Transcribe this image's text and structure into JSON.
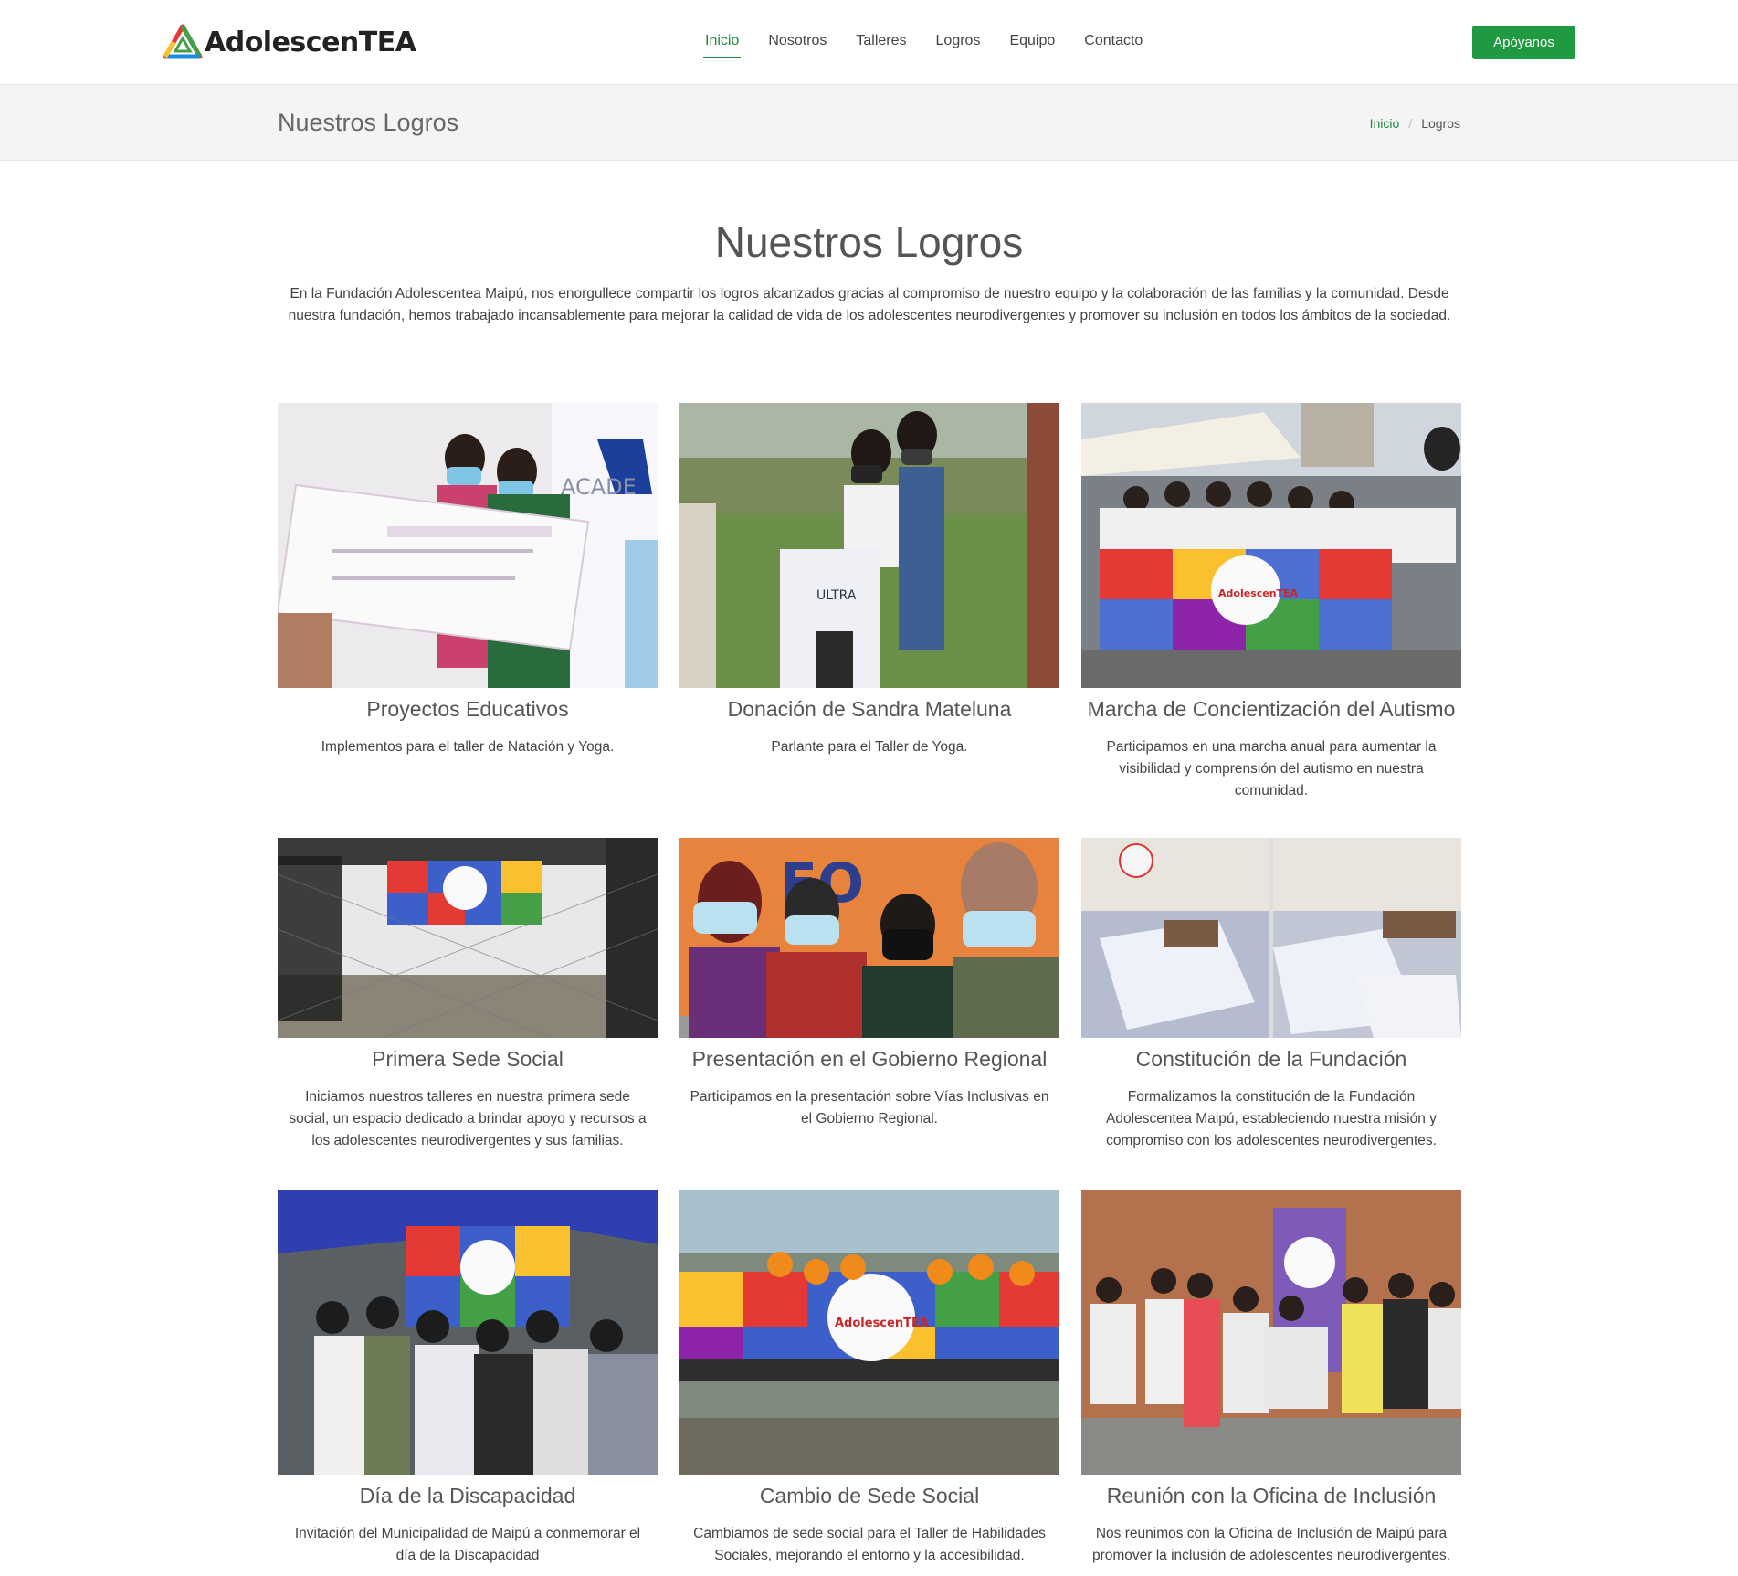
{
  "brand": {
    "name": "AdolescenTEA"
  },
  "nav": {
    "items": [
      "Inicio",
      "Nosotros",
      "Talleres",
      "Logros",
      "Equipo",
      "Contacto"
    ],
    "active": "Inicio",
    "cta": "Apóyanos"
  },
  "page_header": {
    "title": "Nuestros Logros",
    "breadcrumb": {
      "home": "Inicio",
      "separator": "/",
      "current": "Logros"
    }
  },
  "main": {
    "title": "Nuestros Logros",
    "intro": "En la Fundación Adolescentea Maipú, nos enorgullece compartir los logros alcanzados gracias al compromiso de nuestro equipo y la colaboración de las familias y la comunidad. Desde nuestra fundación, hemos trabajado incansablemente para mejorar la calidad de vida de los adolescentes neurodivergentes y promover su inclusión en todos los ámbitos de la sociedad.",
    "cards": [
      {
        "title": "Proyectos Educativos",
        "text": "Implementos para el taller de Natación y Yoga.",
        "photo": "check-ceremony-photo"
      },
      {
        "title": "Donación de Sandra Mateluna",
        "text": "Parlante para el Taller de Yoga.",
        "photo": "speaker-donation-photo"
      },
      {
        "title": "Marcha de Concientización del Autismo",
        "text": "Participamos en una marcha anual para aumentar la visibilidad y comprensión del autismo en nuestra comunidad.",
        "photo": "march-banner-photo"
      },
      {
        "title": "Primera Sede Social",
        "text": "Iniciamos nuestros talleres en nuestra primera sede social, un espacio dedicado a brindar apoyo y recursos a los adolescentes neurodivergentes y sus familias.",
        "photo": "fence-banner-photo"
      },
      {
        "title": "Presentación en el Gobierno Regional",
        "text": "Participamos en la presentación sobre Vías Inclusivas en el Gobierno Regional.",
        "photo": "selfie-group-photo"
      },
      {
        "title": "Constitución de la Fundación",
        "text": "Formalizamos la constitución de la Fundación Adolescentea Maipú, estableciendo nuestra misión y compromiso con los adolescentes neurodivergentes.",
        "photo": "document-signing-photo"
      },
      {
        "title": "Día de la Discapacidad",
        "text": "Invitación del Municipalidad de Maipú a conmemorar el día de la Discapacidad",
        "photo": "tent-event-photo"
      },
      {
        "title": "Cambio de Sede Social",
        "text": "Cambiamos de sede social para el Taller de Habilidades Sociales, mejorando el entorno y la accesibilidad.",
        "photo": "flower-banner-photo"
      },
      {
        "title": "Reunión con la Oficina de Inclusión",
        "text": "Nos reunimos con la Oficina de Inclusión de Maipú para promover la inclusión de adolescentes neurodivergentes.",
        "photo": "group-meeting-photo"
      }
    ]
  },
  "colors": {
    "accent": "#1e8a3a",
    "button": "#1f9a40",
    "header_band": "#f4f4f4"
  }
}
